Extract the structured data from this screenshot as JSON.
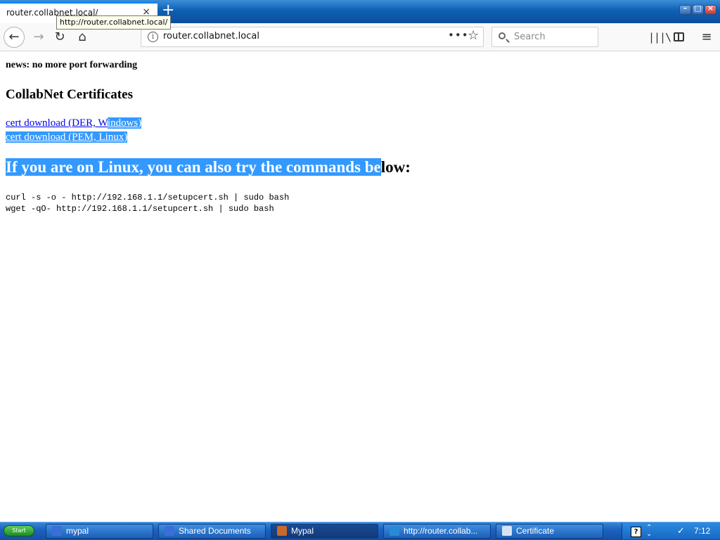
{
  "browser": {
    "tab_title": "router.collabnet.local/",
    "tab_close": "×",
    "new_tab": "+",
    "tooltip": "http://router.collabnet.local/",
    "window_controls": {
      "minimize": "–",
      "maximize": "□",
      "close": "×"
    }
  },
  "toolbar": {
    "back_icon": "←",
    "forward_icon": "→",
    "reload_icon": "↻",
    "home_icon": "⌂",
    "url_host": "router.collabnet.local",
    "page_actions": "•••",
    "bookmark_star": "☆",
    "search_placeholder": "Search",
    "library_icon": "|||\\",
    "menu_icon": "≡"
  },
  "page": {
    "news": "news: no more port forwarding",
    "heading": "CollabNet Certificates",
    "link1_plain": "cert download (DER, W",
    "link1_selected": "indows)",
    "link2": "cert download (PEM, Linux)",
    "h1_selected": "If you are on Linux, you can also try the commands be",
    "h1_rest": "low:",
    "cmd1": "curl -s -o - http://192.168.1.1/setupcert.sh | sudo bash",
    "cmd2": "wget -qO- http://192.168.1.1/setupcert.sh | sudo bash"
  },
  "taskbar": {
    "start_label": "Start",
    "items": [
      {
        "label": "mypal",
        "icon_color": "#3a6fd8"
      },
      {
        "label": "Shared Documents",
        "icon_color": "#3a6fd8"
      },
      {
        "label": "Mypal",
        "icon_color": "#c86a2a"
      },
      {
        "label": "http://router.collab...",
        "icon_color": "#2a8ad8"
      },
      {
        "label": "Certificate",
        "icon_color": "#d8e4f4"
      }
    ],
    "clock": "7:12"
  },
  "colors": {
    "selection": "#3399ff",
    "link": "#0000ee",
    "taskbar": "#1d63c0"
  }
}
